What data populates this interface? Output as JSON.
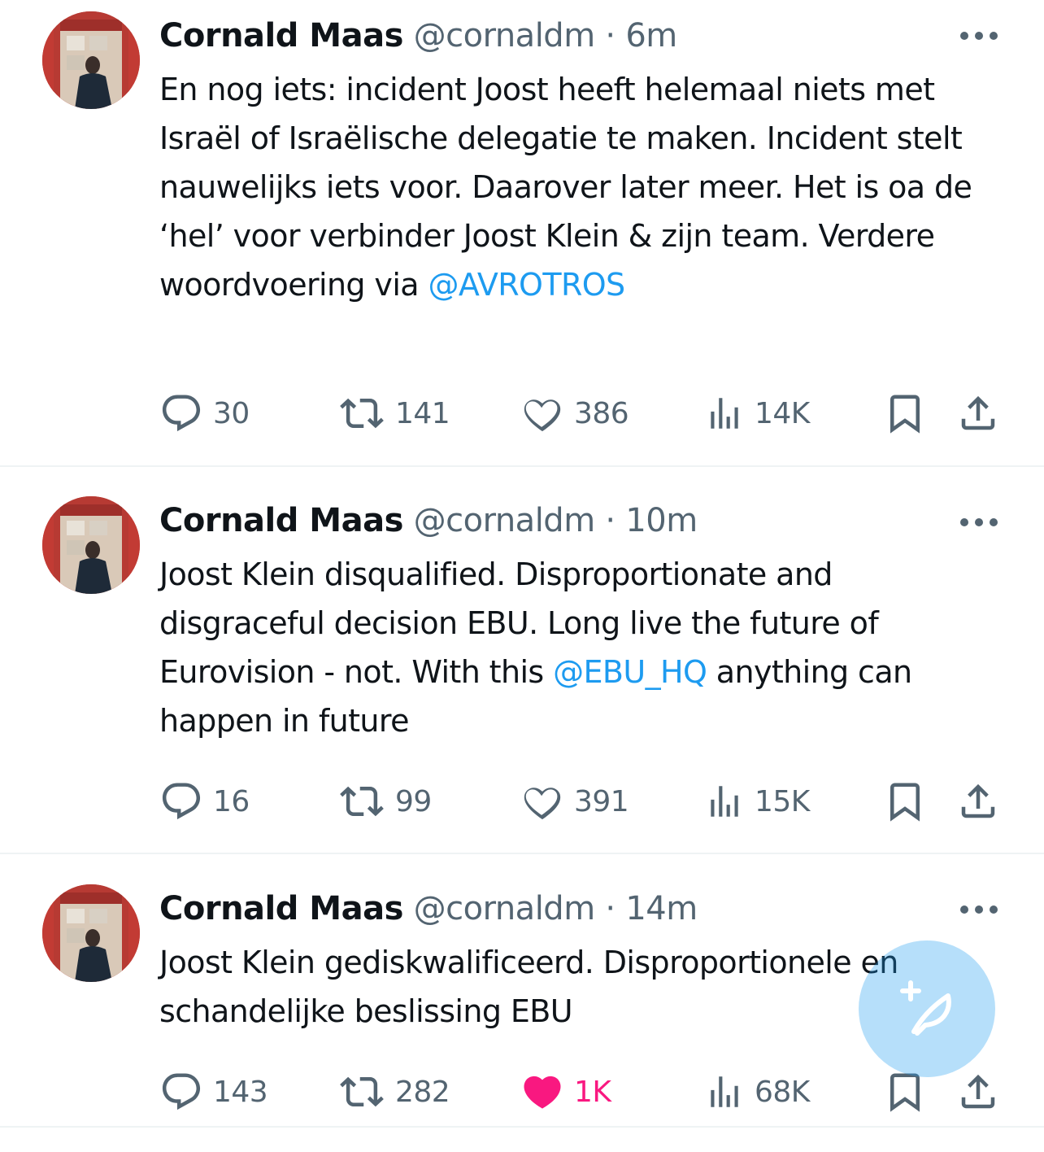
{
  "tweets": [
    {
      "name": "Cornald Maas",
      "handle": "@cornaldm",
      "separator": "·",
      "time": "6m",
      "text_parts": [
        "En nog iets: incident Joost heeft helemaal niets met Israël of Israëlische delegatie te maken. Incident stelt nauwelijks iets voor. Daarover later meer. Het is oa de ‘hel’ voor verbinder Joost Klein & zijn team. Verdere woordvoering via ",
        "@AVROTROS"
      ],
      "replies": "30",
      "reposts": "141",
      "likes": "386",
      "views": "14K",
      "liked": false
    },
    {
      "name": "Cornald Maas",
      "handle": "@cornaldm",
      "separator": "·",
      "time": "10m",
      "text_parts": [
        "Joost Klein disqualified. Disproportionate and disgraceful decision EBU. Long live the future of Eurovision - not. With this ",
        "@EBU_HQ",
        " anything can happen in future"
      ],
      "replies": "16",
      "reposts": "99",
      "likes": "391",
      "views": "15K",
      "liked": false
    },
    {
      "name": "Cornald Maas",
      "handle": "@cornaldm",
      "separator": "·",
      "time": "14m",
      "text_parts": [
        "Joost Klein gediskwalificeerd. Disproportionele en schandelijke beslissing EBU"
      ],
      "replies": "143",
      "reposts": "282",
      "likes": "1K",
      "views": "68K",
      "liked": true
    }
  ],
  "icons": {
    "more": "more-horizontal-icon",
    "reply": "reply-icon",
    "repost": "repost-icon",
    "like": "heart-icon",
    "views": "views-icon",
    "bookmark": "bookmark-icon",
    "share": "share-icon",
    "compose": "compose-post-icon"
  },
  "colors": {
    "text": "#0f1419",
    "secondary": "#536471",
    "link": "#1d9bf0",
    "like_active": "#f91880",
    "divider": "#eff3f4",
    "fab": "#1d9bf0"
  }
}
